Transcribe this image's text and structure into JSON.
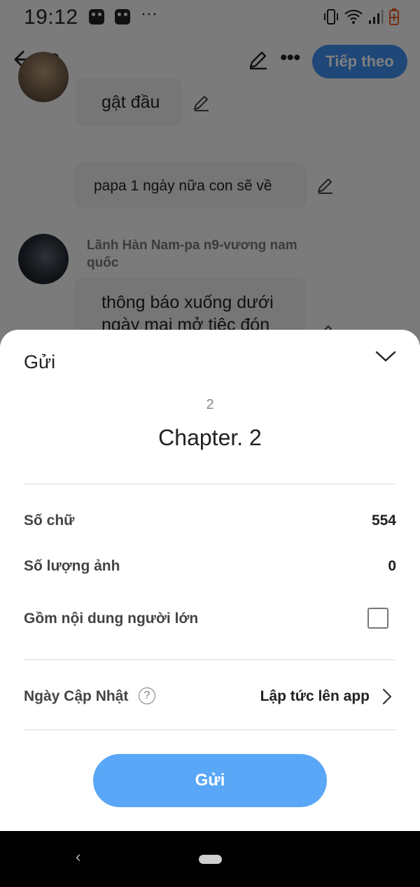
{
  "status_bar": {
    "time": "19:12",
    "more": "···",
    "icons": [
      "app-notification-icon",
      "app-notification-icon",
      "vibrate-icon",
      "wifi-icon",
      "signal-icon",
      "battery-low-icon"
    ]
  },
  "toolbar": {
    "title": "2",
    "next_label": "Tiếp theo"
  },
  "chat": {
    "messages": [
      {
        "text": "gật đầu"
      },
      {
        "text": "papa 1 ngày nữa con sẽ về"
      },
      {
        "sender": "Lãnh Hàn Nam-pa n9-vương nam quốc",
        "text": "thông báo xuống dưới ngày mai mở tiệc đón"
      }
    ]
  },
  "sheet": {
    "title": "Gửi",
    "chapter_number": "2",
    "chapter_title": "Chapter. 2",
    "stats": {
      "word_count_label": "Số chữ",
      "word_count_value": "554",
      "image_count_label": "Số lượng ảnh",
      "image_count_value": "0",
      "adult_content_label": "Gồm nội dung người lớn",
      "adult_content_checked": false
    },
    "update": {
      "label": "Ngày Cập Nhật",
      "help": "?",
      "value": "Lập tức lên app"
    },
    "send_label": "Gửi"
  },
  "colors": {
    "accent": "#3f8ef0",
    "send_button": "#5aa7f7",
    "battery": "#e65a28"
  }
}
